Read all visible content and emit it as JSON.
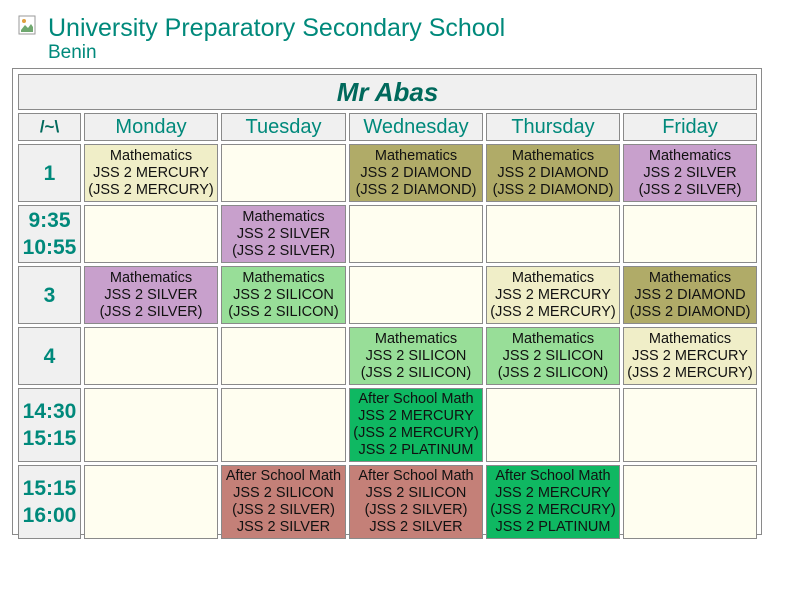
{
  "header": {
    "logo_alt": "",
    "school_name": "University Preparatory Secondary School",
    "location": "Benin"
  },
  "timetable": {
    "teacher": "Mr Abas",
    "corner_label": "/~\\",
    "days": [
      "Monday",
      "Tuesday",
      "Wednesday",
      "Thursday",
      "Friday"
    ],
    "colors": {
      "empty": "#fffef0",
      "cream": "#f0eec8",
      "olive": "#b0ab68",
      "purple": "#c8a0cc",
      "light_green": "#98de98",
      "green": "#0fb862",
      "rose": "#c48078"
    },
    "rows": [
      {
        "period": [
          "1"
        ],
        "cells": [
          {
            "color": "cream",
            "lines": [
              "Mathematics",
              "JSS 2 MERCURY",
              "(JSS 2 MERCURY)"
            ]
          },
          {
            "color": "empty",
            "lines": []
          },
          {
            "color": "olive",
            "lines": [
              "Mathematics",
              "JSS 2 DIAMOND",
              "(JSS 2 DIAMOND)"
            ]
          },
          {
            "color": "olive",
            "lines": [
              "Mathematics",
              "JSS 2 DIAMOND",
              "(JSS 2 DIAMOND)"
            ]
          },
          {
            "color": "purple",
            "lines": [
              "Mathematics",
              "JSS 2 SILVER",
              "(JSS 2 SILVER)"
            ]
          }
        ]
      },
      {
        "period": [
          "9:35",
          "10:55"
        ],
        "cells": [
          {
            "color": "empty",
            "lines": []
          },
          {
            "color": "purple",
            "lines": [
              "Mathematics",
              "JSS 2 SILVER",
              "(JSS 2 SILVER)"
            ]
          },
          {
            "color": "empty",
            "lines": []
          },
          {
            "color": "empty",
            "lines": []
          },
          {
            "color": "empty",
            "lines": []
          }
        ]
      },
      {
        "period": [
          "3"
        ],
        "cells": [
          {
            "color": "purple",
            "lines": [
              "Mathematics",
              "JSS 2 SILVER",
              "(JSS 2 SILVER)"
            ]
          },
          {
            "color": "light_green",
            "lines": [
              "Mathematics",
              "JSS 2 SILICON",
              "(JSS 2 SILICON)"
            ]
          },
          {
            "color": "empty",
            "lines": []
          },
          {
            "color": "cream",
            "lines": [
              "Mathematics",
              "JSS 2 MERCURY",
              "(JSS 2 MERCURY)"
            ]
          },
          {
            "color": "olive",
            "lines": [
              "Mathematics",
              "JSS 2 DIAMOND",
              "(JSS 2 DIAMOND)"
            ]
          }
        ]
      },
      {
        "period": [
          "4"
        ],
        "cells": [
          {
            "color": "empty",
            "lines": []
          },
          {
            "color": "empty",
            "lines": []
          },
          {
            "color": "light_green",
            "lines": [
              "Mathematics",
              "JSS 2 SILICON",
              "(JSS 2 SILICON)"
            ]
          },
          {
            "color": "light_green",
            "lines": [
              "Mathematics",
              "JSS 2 SILICON",
              "(JSS 2 SILICON)"
            ]
          },
          {
            "color": "cream",
            "lines": [
              "Mathematics",
              "JSS 2 MERCURY",
              "(JSS 2 MERCURY)"
            ]
          }
        ]
      },
      {
        "period": [
          "14:30",
          "15:15"
        ],
        "cells": [
          {
            "color": "empty",
            "lines": []
          },
          {
            "color": "empty",
            "lines": []
          },
          {
            "color": "green",
            "lines": [
              "After School Math",
              "JSS 2 MERCURY",
              "(JSS 2 MERCURY)",
              "JSS 2 PLATINUM"
            ]
          },
          {
            "color": "empty",
            "lines": []
          },
          {
            "color": "empty",
            "lines": []
          }
        ]
      },
      {
        "period": [
          "15:15",
          "16:00"
        ],
        "cells": [
          {
            "color": "empty",
            "lines": []
          },
          {
            "color": "rose",
            "lines": [
              "After School Math",
              "JSS 2 SILICON",
              "(JSS 2 SILVER)",
              "JSS 2 SILVER"
            ]
          },
          {
            "color": "rose",
            "lines": [
              "After School Math",
              "JSS 2 SILICON",
              "(JSS 2 SILVER)",
              "JSS 2 SILVER"
            ]
          },
          {
            "color": "green",
            "lines": [
              "After School Math",
              "JSS 2 MERCURY",
              "(JSS 2 MERCURY)",
              "JSS 2 PLATINUM"
            ]
          },
          {
            "color": "empty",
            "lines": []
          }
        ]
      }
    ]
  }
}
